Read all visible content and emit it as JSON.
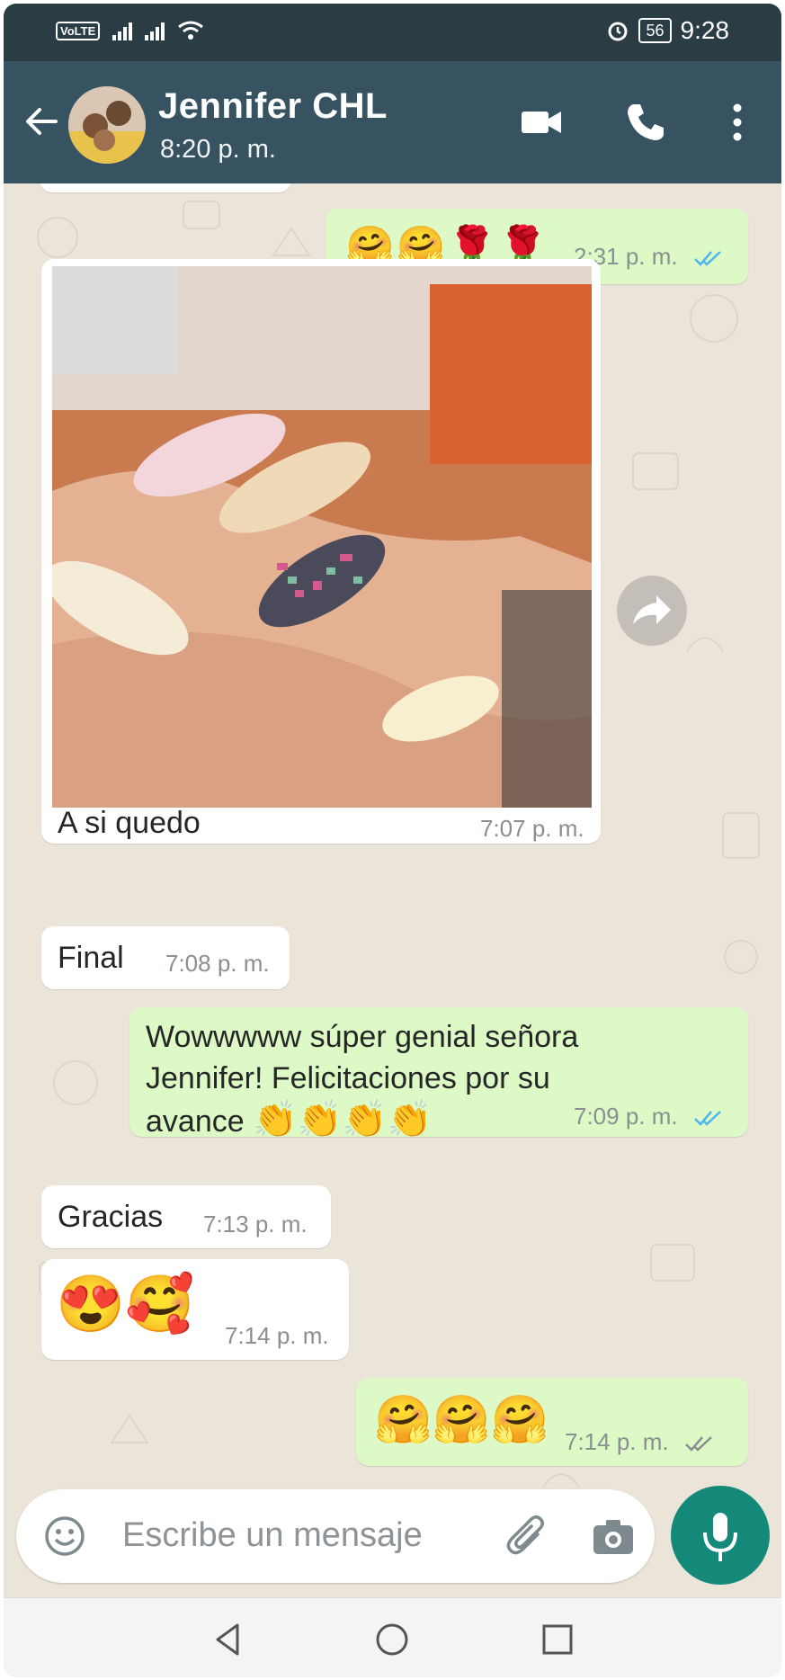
{
  "status_bar": {
    "volte_label": "VoLTE",
    "battery": "56",
    "time": "9:28"
  },
  "header": {
    "contact_name": "Jennifer CHL",
    "last_seen": "8:20 p. m."
  },
  "messages": [
    {
      "direction": "out",
      "emojis": "🤗🤗🌹🌹",
      "time": "2:31 p. m.",
      "ticks": "read"
    },
    {
      "direction": "in",
      "type": "image",
      "image_desc": "manicured nails photo",
      "caption": "A si quedo",
      "time": "7:07 p. m."
    },
    {
      "direction": "in",
      "text": "Final",
      "time": "7:08 p. m."
    },
    {
      "direction": "out",
      "text_lines": [
        "Wowwwww súper genial señora",
        "Jennifer! Felicitaciones por su",
        "avance"
      ],
      "emojis": "👏👏👏👏",
      "time": "7:09 p. m.",
      "ticks": "read"
    },
    {
      "direction": "in",
      "text": "Gracias",
      "time": "7:13 p. m."
    },
    {
      "direction": "in",
      "emojis": "😍🥰",
      "time": "7:14 p. m."
    },
    {
      "direction": "out",
      "emojis": "🤗🤗🤗",
      "time": "7:14 p. m.",
      "ticks": "delivered"
    }
  ],
  "input": {
    "placeholder": "Escribe un mensaje"
  },
  "colors": {
    "header": "#375260",
    "chat_bg": "#ebe4d9",
    "outgoing_bubble": "#dcf9c6",
    "incoming_bubble": "#ffffff",
    "read_ticks": "#4fb6ec",
    "mic_button": "#14897a"
  },
  "icons": [
    "back-arrow-icon",
    "video-call-icon",
    "phone-call-icon",
    "more-options-icon",
    "forward-icon",
    "emoji-icon",
    "attach-icon",
    "camera-icon",
    "mic-icon",
    "nav-back-icon",
    "nav-home-icon",
    "nav-recents-icon"
  ]
}
